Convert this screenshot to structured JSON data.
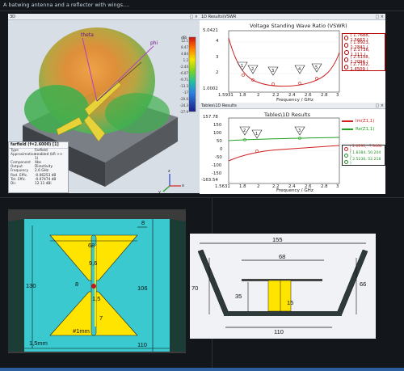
{
  "caption": "A batwing antenna and a reflector with wings....",
  "panel3d": {
    "header": "3D",
    "controls": "□ ×",
    "axis_labels": {
      "theta": "theta",
      "phi": "phi",
      "x": "x",
      "y": "y",
      "z": "z"
    },
    "colorbar": {
      "unit": "dBi",
      "labels": [
        "12.1",
        "8.47",
        "4.84",
        "1.2",
        "-2.44",
        "-6.07",
        "-9.71",
        "-13.3",
        "-17",
        "-20.6",
        "-24.3",
        "-27.9"
      ]
    },
    "info": {
      "title": "farfield (f=2.6000) [1]",
      "rows": [
        {
          "k": "Type",
          "v": "Farfield"
        },
        {
          "k": "Approximation",
          "v": "enabled (kR >> 1)"
        },
        {
          "k": "Component",
          "v": "Abs"
        },
        {
          "k": "Output",
          "v": "Directivity"
        },
        {
          "k": "Frequency",
          "v": "2.6 GHz"
        },
        {
          "k": "Rad. Effic.",
          "v": "-0.06253 dB"
        },
        {
          "k": "Tot. Effic.",
          "v": "-0.07474 dB"
        },
        {
          "k": "Dir.",
          "v": "12.11 dBi"
        }
      ]
    }
  },
  "vswr": {
    "header": "1D Results\\VSWR",
    "controls": "□ ×",
    "title": "Voltage Standing Wave Ratio (VSWR)",
    "ylabel": "",
    "xlabel": "Frequency / GHz",
    "ytop": "5.0421",
    "ybottom": "1.0002",
    "yticks": [
      "4",
      "3",
      "2"
    ],
    "xstart": "1.5931",
    "xticks": [
      "1.8",
      "2",
      "2.2",
      "2.4",
      "2.6",
      "2.8",
      "3"
    ],
    "legend": [
      "( 1.7688, 1.5663 )",
      "( 1.8923, 1.2841 )",
      "( 2.1736, 1.111 )",
      "( 2.5158, 1.2094 )",
      "( 2.7182, 1.4509 )"
    ],
    "markers": [
      "1",
      "2",
      "3",
      "4",
      "5"
    ],
    "accent": "#cc2222"
  },
  "tables": {
    "header": "Tables\\1D Results",
    "controls": "□ ×",
    "title": "Tables\\1D Results",
    "xlabel": "Frequency / GHz",
    "ytop": "157.78",
    "ybottom": "-163.54",
    "yticks": [
      "150",
      "100",
      "50",
      "0",
      "-50",
      "-100",
      "-150"
    ],
    "xstart": "1.5631",
    "xticks": [
      "1.8",
      "2",
      "2.2",
      "2.4",
      "2.6",
      "2.8",
      "3"
    ],
    "series_legend": [
      {
        "name": "Im(Z1,1)",
        "color": "#d02020"
      },
      {
        "name": "Re(Z1,1)",
        "color": "#20a020"
      }
    ],
    "marker_legend": [
      {
        "text": "( 2.0291, -7.3464 )",
        "color": "#cc2222"
      },
      {
        "text": "( 1.8384, 50.204 )",
        "color": "#209020"
      },
      {
        "text": "( 2.5236, 52.218 )",
        "color": "#209020"
      }
    ],
    "markers": [
      "1",
      "2",
      "3"
    ]
  },
  "leftDrawing": {
    "dims": {
      "d8top": "8",
      "d68": "68",
      "d96": "9,6",
      "d8mid": "8",
      "d130": "130",
      "d106": "106",
      "d15": "1,5",
      "d7": "7",
      "d1mm": "#1mm",
      "d15mm": "1,5mm",
      "d110": "110"
    }
  },
  "rightDrawing": {
    "dims": {
      "d155": "155",
      "d68": "68",
      "d70": "70",
      "d66": "66",
      "d35": "35",
      "d15": "15",
      "d110": "110"
    }
  }
}
